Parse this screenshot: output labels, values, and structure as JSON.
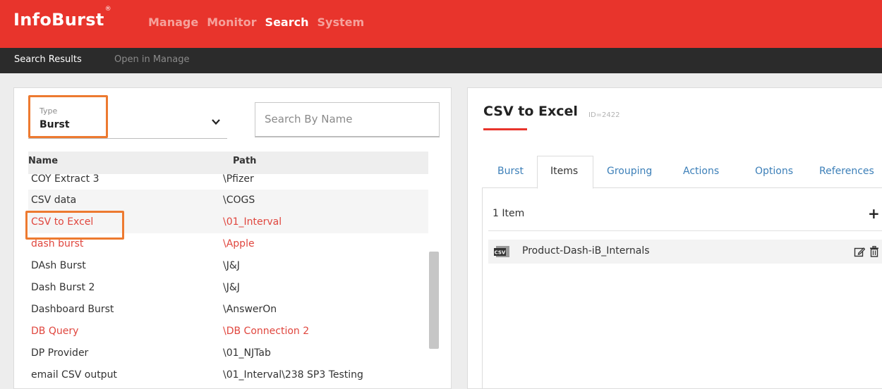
{
  "brand": {
    "name": "InfoBurst",
    "mark": "®"
  },
  "main_nav": [
    {
      "label": "Manage",
      "active": false
    },
    {
      "label": "Monitor",
      "active": false
    },
    {
      "label": "Search",
      "active": true
    },
    {
      "label": "System",
      "active": false
    }
  ],
  "sub_nav": {
    "results": "Search Results",
    "open": "Open in Manage"
  },
  "filter": {
    "type_label": "Type",
    "type_value": "Burst",
    "search_placeholder": "Search By Name"
  },
  "table": {
    "headers": {
      "name": "Name",
      "path": "Path"
    },
    "rows": [
      {
        "name": "COY Extract 3",
        "path": "\\Pfizer",
        "red": false,
        "alt": false
      },
      {
        "name": "CSV data",
        "path": "\\COGS",
        "red": false,
        "alt": true
      },
      {
        "name": "CSV to Excel",
        "path": "\\01_Interval",
        "red": true,
        "alt": false
      },
      {
        "name": "dash burst",
        "path": "\\Apple",
        "red": true,
        "alt": false
      },
      {
        "name": "DAsh Burst",
        "path": "\\J&J",
        "red": false,
        "alt": false
      },
      {
        "name": "Dash Burst 2",
        "path": "\\J&J",
        "red": false,
        "alt": false
      },
      {
        "name": "Dashboard Burst",
        "path": "\\AnswerOn",
        "red": false,
        "alt": false
      },
      {
        "name": "DB Query",
        "path": "\\DB Connection 2",
        "red": true,
        "alt": false
      },
      {
        "name": "DP Provider",
        "path": "\\01_NJTab",
        "red": false,
        "alt": false
      },
      {
        "name": "email CSV output",
        "path": "\\01_Interval\\238 SP3 Testing",
        "red": false,
        "alt": false
      }
    ]
  },
  "detail": {
    "title": "CSV to Excel",
    "id": "ID=2422",
    "tabs": [
      "Burst",
      "Items",
      "Grouping",
      "Actions",
      "Options",
      "References"
    ],
    "active_tab": "Items",
    "item_count": "1 Item",
    "add_symbol": "+",
    "items": [
      {
        "name": "Product-Dash-iB_Internals",
        "icon_text": "CSV"
      }
    ]
  },
  "colors": {
    "brand_red": "#e8342c",
    "dark_bar": "#2b2b2b",
    "highlight": "#ed7a30",
    "link_blue": "#3c7fb8"
  }
}
